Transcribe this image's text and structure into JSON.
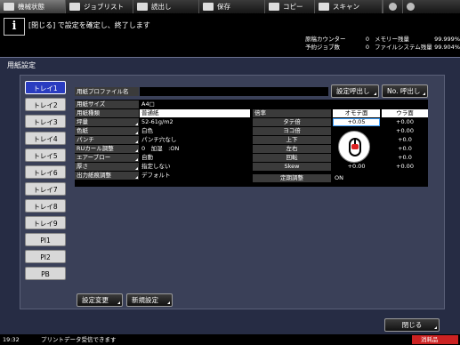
{
  "tabs": [
    {
      "label": "機械状態",
      "active": true
    },
    {
      "label": "ジョブリスト",
      "active": false
    },
    {
      "label": "読出し",
      "active": false
    },
    {
      "label": "保存",
      "active": false
    },
    {
      "label": "コピー",
      "active": false
    },
    {
      "label": "スキャン",
      "active": false
    }
  ],
  "top_icons": [
    "settings-icon",
    "help-icon"
  ],
  "message": "[閉じる] で設定を確定し、終了します",
  "counters": [
    {
      "label": "原稿カウンター",
      "value": "0",
      "label2": "メモリー残量",
      "value2": "99.999%"
    },
    {
      "label": "予約ジョブ数",
      "value": "0",
      "label2": "ファイルシステム残量",
      "value2": "99.904%"
    }
  ],
  "panel_title": "用紙設定",
  "trays": [
    "トレイ1",
    "トレイ2",
    "トレイ3",
    "トレイ4",
    "トレイ5",
    "トレイ6",
    "トレイ7",
    "トレイ8",
    "トレイ9",
    "PI1",
    "PI2",
    "PB"
  ],
  "active_tray": "トレイ1",
  "profile": {
    "label": "用紙プロファイル名",
    "value": "",
    "recall_button": "設定呼出し",
    "no_recall_button": "No. 呼出し"
  },
  "settings": [
    {
      "label": "用紙サイズ",
      "value": "A4□"
    },
    {
      "label": "用紙種類",
      "value": "普通紙"
    },
    {
      "label": "坪量",
      "value": "52-61g/m2"
    },
    {
      "label": "色紙",
      "value": "白色"
    },
    {
      "label": "パンチ",
      "value": "パンチ穴なし"
    },
    {
      "label": "RUカール調整",
      "value": "0　加湿　:ON"
    },
    {
      "label": "エアーブロー",
      "value": "自動"
    },
    {
      "label": "厚さ",
      "value": "指定しない"
    },
    {
      "label": "出力紙痕調整",
      "value": "デフォルト"
    }
  ],
  "adjust": {
    "header_label": "倍率",
    "col_front": "オモテ面",
    "col_back": "ウラ面",
    "rows": [
      {
        "label": "タテ倍",
        "front": "+0.05",
        "back": "+0.00"
      },
      {
        "label": "ヨコ倍",
        "front": "",
        "back": "+0.00"
      },
      {
        "label": "上下",
        "front": "",
        "back": "+0.0"
      },
      {
        "label": "左右",
        "front": "",
        "back": "+0.0"
      },
      {
        "label": "回転",
        "front": "",
        "back": "+0.0"
      },
      {
        "label": "Skew",
        "front": "+0.00",
        "back": "+0.00"
      }
    ],
    "fixed_label": "定期調整",
    "fixed_value": "ON"
  },
  "buttons": {
    "change": "設定変更",
    "new": "新規設定",
    "close": "閉じる"
  },
  "status": {
    "time": "19:32",
    "text": "プリントデータ受信できます",
    "supply": "消耗品"
  }
}
